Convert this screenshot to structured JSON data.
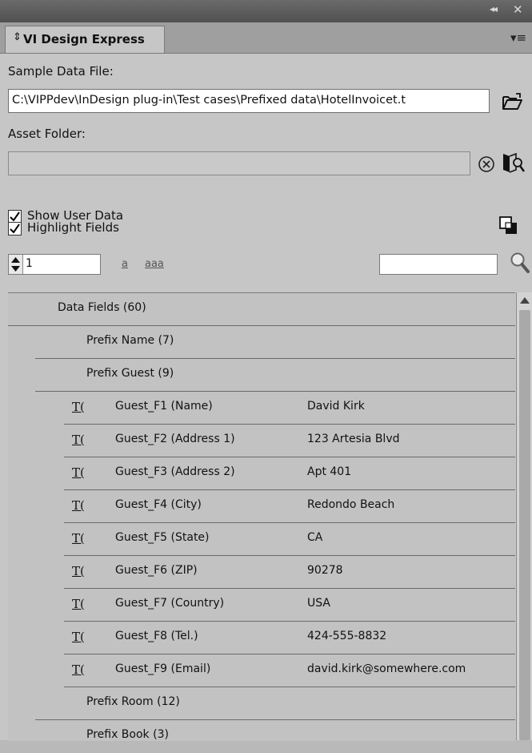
{
  "panel": {
    "tab_label": "VI Design Express",
    "tab_collapse_icon": "double-chevron-left-icon",
    "close_label": "✕",
    "menu_icon": "panel-menu-icon"
  },
  "sample_data": {
    "label": "Sample Data File:",
    "path": "C:\\VIPPdev\\InDesign plug-in\\Test cases\\Prefixed data\\HotelInvoicet.t"
  },
  "asset_folder": {
    "label": "Asset Folder:",
    "path": ""
  },
  "options": {
    "show_user_data": {
      "label": "Show User Data",
      "checked": true
    },
    "highlight_fields": {
      "label": "Highlight Fields",
      "checked": true
    }
  },
  "record": {
    "value": "1"
  },
  "case_buttons": {
    "lower_single": "a",
    "lower_multi": "aaa"
  },
  "search": {
    "value": ""
  },
  "tree": {
    "root": {
      "label": "Data Fields (60)",
      "expanded": true
    },
    "groups": [
      {
        "label": "Prefix Name (7)",
        "expanded": false
      },
      {
        "label": "Prefix Guest (9)",
        "expanded": true,
        "fields": [
          {
            "name": "Guest_F1 (Name)",
            "value": "David Kirk"
          },
          {
            "name": "Guest_F2 (Address 1)",
            "value": "123 Artesia Blvd"
          },
          {
            "name": "Guest_F3 (Address 2)",
            "value": "Apt 401"
          },
          {
            "name": "Guest_F4 (City)",
            "value": "Redondo Beach"
          },
          {
            "name": "Guest_F5 (State)",
            "value": "CA"
          },
          {
            "name": "Guest_F6 (ZIP)",
            "value": "90278"
          },
          {
            "name": "Guest_F7 (Country)",
            "value": "USA"
          },
          {
            "name": "Guest_F8 (Tel.)",
            "value": "424-555-8832"
          },
          {
            "name": "Guest_F9 (Email)",
            "value": "david.kirk@somewhere.com"
          }
        ]
      },
      {
        "label": "Prefix Room (12)",
        "expanded": false
      },
      {
        "label": "Prefix Book (3)",
        "expanded": false
      }
    ]
  }
}
